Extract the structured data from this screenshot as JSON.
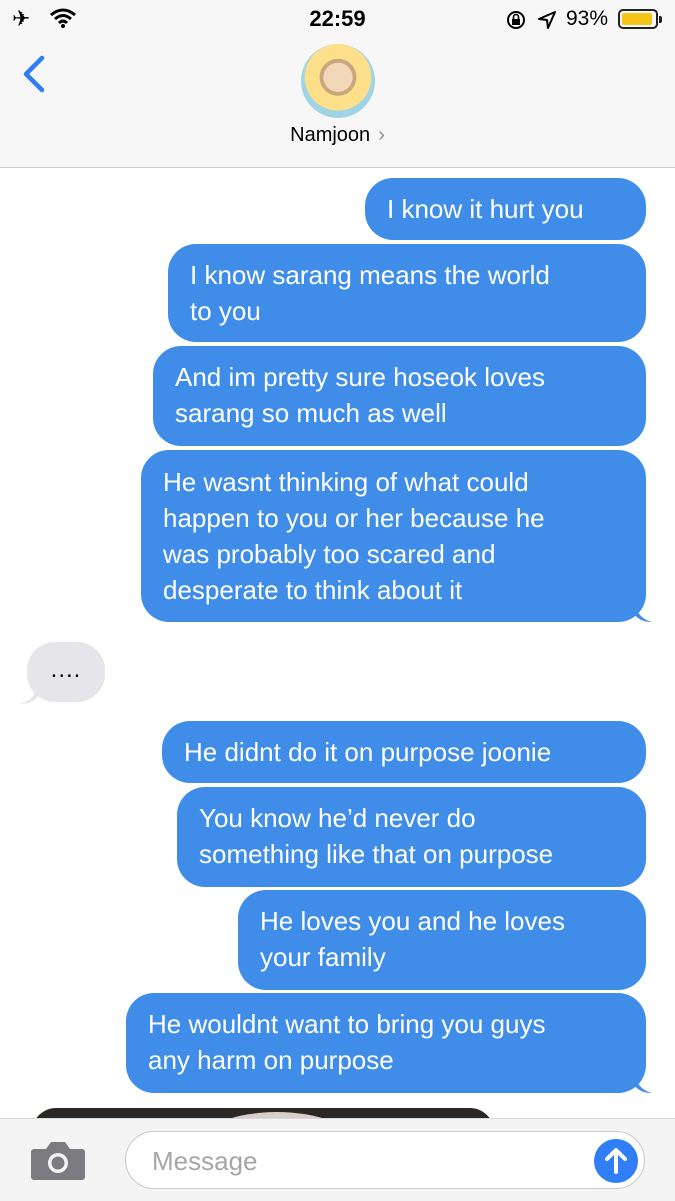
{
  "status": {
    "time": "22:59",
    "battery_pct": "93%",
    "battery_level": 0.93,
    "icons": [
      "airplane-icon",
      "wifi-icon",
      "orientation-lock-icon",
      "location-icon",
      "battery-icon"
    ]
  },
  "nav": {
    "contact_name": "Namjoon",
    "chevron": "›"
  },
  "messages": [
    {
      "side": "sent",
      "text_lines": [
        "I know it hurt you"
      ]
    },
    {
      "side": "sent",
      "text_lines": [
        "I know sarang means the world",
        "to you"
      ]
    },
    {
      "side": "sent",
      "text_lines": [
        "And im pretty sure hoseok loves",
        "sarang so much as well"
      ]
    },
    {
      "side": "sent",
      "text_lines": [
        "He wasnt thinking of what could",
        "happen to you or her because he",
        "was probably too scared and",
        "desperate to think about it"
      ]
    },
    {
      "side": "received",
      "text_lines": [
        "...."
      ]
    },
    {
      "side": "sent",
      "text_lines": [
        "He didnt do it on purpose joonie"
      ]
    },
    {
      "side": "sent",
      "text_lines": [
        "You know he’d never do",
        "something like that on purpose"
      ]
    },
    {
      "side": "sent",
      "text_lines": [
        "He loves you and he loves",
        "your family"
      ]
    },
    {
      "side": "sent",
      "text_lines": [
        "He wouldnt want to bring you guys",
        "any harm on purpose"
      ]
    }
  ],
  "composer": {
    "placeholder": "Message"
  },
  "colors": {
    "sent_bubble": "#3f8de9",
    "received_bubble": "#e5e5ea",
    "accent": "#2f7ef5"
  }
}
